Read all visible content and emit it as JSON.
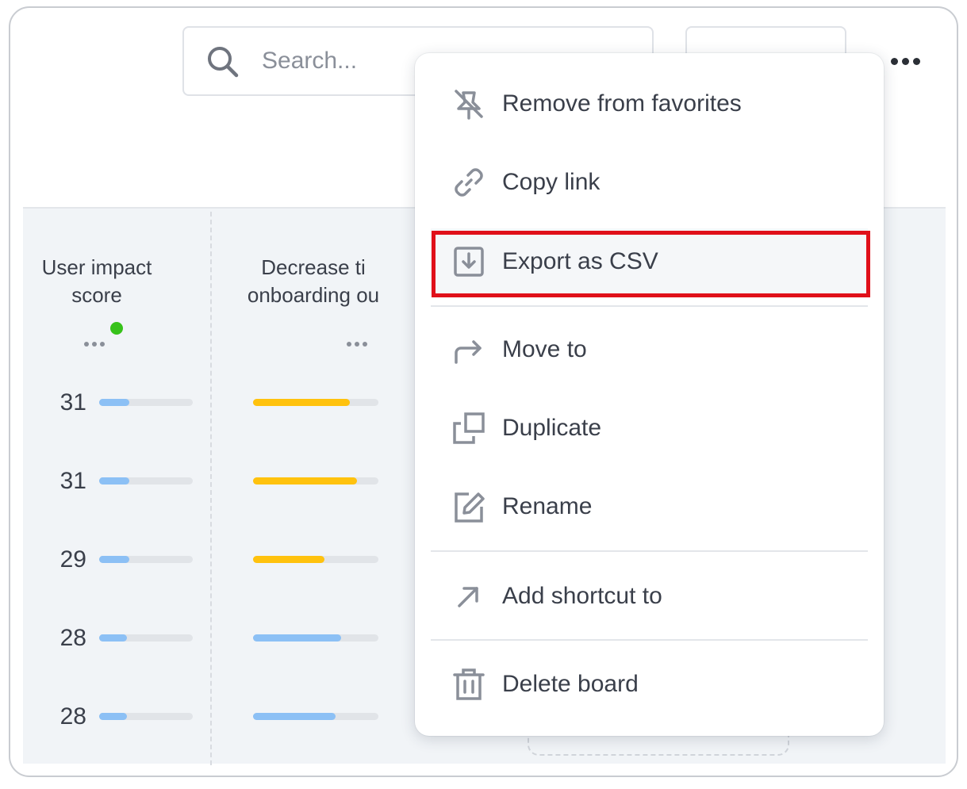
{
  "search": {
    "placeholder": "Search..."
  },
  "board": {
    "columns": [
      {
        "title_line1": "User impact",
        "title_line2": "score"
      },
      {
        "title_line1": "Decrease ti",
        "title_line2": "onboarding ou"
      }
    ],
    "rows": [
      {
        "score": "31",
        "impact_fill": 0.32,
        "col2_fill": 0.77,
        "col2_color": "#ffc20e"
      },
      {
        "score": "31",
        "impact_fill": 0.32,
        "col2_fill": 0.83,
        "col2_color": "#ffc20e"
      },
      {
        "score": "29",
        "impact_fill": 0.32,
        "col2_fill": 0.57,
        "col2_color": "#ffc20e"
      },
      {
        "score": "28",
        "impact_fill": 0.3,
        "col2_fill": 0.7,
        "col2_color": "#8cc0f5"
      },
      {
        "score": "28",
        "impact_fill": 0.3,
        "col2_fill": 0.66,
        "col2_color": "#8cc0f5"
      }
    ],
    "impact_bar_color": "#8cc0f5"
  },
  "menu": {
    "items": [
      {
        "label": "Remove from favorites",
        "icon": "star-off-icon"
      },
      {
        "label": "Copy link",
        "icon": "link-icon"
      },
      {
        "label": "Export as CSV",
        "icon": "export-icon"
      },
      {
        "label": "Move to",
        "icon": "move-arrow-icon"
      },
      {
        "label": "Duplicate",
        "icon": "duplicate-icon"
      },
      {
        "label": "Rename",
        "icon": "rename-icon"
      },
      {
        "label": "Add shortcut to",
        "icon": "shortcut-arrow-icon"
      },
      {
        "label": "Delete board",
        "icon": "trash-icon"
      }
    ],
    "highlight_color": "#e0101a"
  }
}
